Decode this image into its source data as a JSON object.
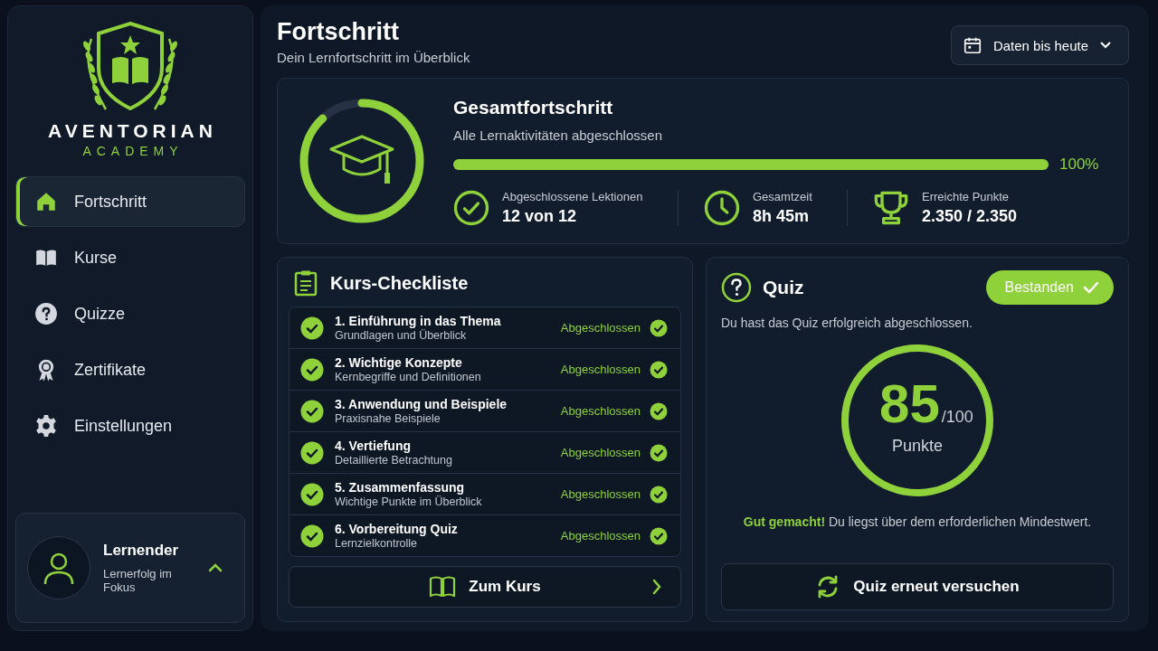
{
  "brand": {
    "name": "AVENTORIAN",
    "subtitle": "ACADEMY"
  },
  "nav": [
    {
      "label": "Fortschritt",
      "kind": "home",
      "selected": true
    },
    {
      "label": "Kurse",
      "kind": "book",
      "selected": false
    },
    {
      "label": "Quizze",
      "kind": "question",
      "selected": false
    },
    {
      "label": "Zertifikate",
      "kind": "award",
      "selected": false
    },
    {
      "label": "Einstellungen",
      "kind": "gear",
      "selected": false
    }
  ],
  "user": {
    "name": "Lernender",
    "subtitle": "Lernerfolg im Fokus"
  },
  "header": {
    "title": "Fortschritt",
    "subtitle": "Dein Lernfortschritt im Überblick",
    "date_button": "Daten bis heute"
  },
  "overall": {
    "title": "Gesamtfortschritt",
    "subtitle": "Alle Lernaktivitäten abgeschlossen",
    "ring": {
      "level": 0.88
    },
    "level": 1,
    "percent": "100%",
    "stats": [
      {
        "kind": "check",
        "label": "Abgeschlossene Lektionen",
        "value": "12 von 12"
      },
      {
        "kind": "clock",
        "label": "Gesamtzeit",
        "value": "8h 45m"
      },
      {
        "kind": "trophy",
        "label": "Erreichte Punkte",
        "value": "2.350 / 2.350"
      }
    ]
  },
  "checklist": {
    "title": "Kurs-Checkliste",
    "items": [
      {
        "title": "1. Einführung in das Thema",
        "subtitle": "Grundlagen und Überblick",
        "status": "Abgeschlossen",
        "done": true
      },
      {
        "title": "2. Wichtige Konzepte",
        "subtitle": "Kernbegriffe und Definitionen",
        "status": "Abgeschlossen",
        "done": true
      },
      {
        "title": "3. Anwendung und Beispiele",
        "subtitle": "Praxisnahe Beispiele",
        "status": "Abgeschlossen",
        "done": true
      },
      {
        "title": "4. Vertiefung",
        "subtitle": "Detaillierte Betrachtung",
        "status": "Abgeschlossen",
        "done": true
      },
      {
        "title": "5. Zusammenfassung",
        "subtitle": "Wichtige Punkte im Überblick",
        "status": "Abgeschlossen",
        "done": true
      },
      {
        "title": "6. Vorbereitung Quiz",
        "subtitle": "Lernzielkontrolle",
        "status": "Abgeschlossen",
        "done": true
      }
    ],
    "button": "Zum Kurs"
  },
  "quiz": {
    "title": "Quiz",
    "badge": "Bestanden",
    "description": "Du hast das Quiz erfolgreich abgeschlossen.",
    "score": "85",
    "max": "/100",
    "unit": "Punkte",
    "level": 1,
    "message": "**Gut gemacht!** Du liegst über dem erforderlichen Mindestwert.",
    "button": "Quiz erneut versuchen"
  }
}
